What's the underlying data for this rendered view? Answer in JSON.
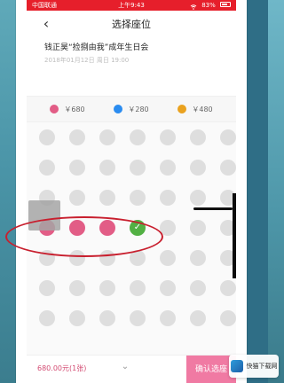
{
  "status": {
    "carrier": "中国联通",
    "time": "上午9:43",
    "battery": "83%"
  },
  "nav": {
    "title": "选择座位",
    "back_icon": "chevron-left-icon"
  },
  "event": {
    "name": "钱正昊“捡捌由我”成年生日会",
    "time": "2018年01月12日 周日 19:00"
  },
  "legend": [
    {
      "label": "￥680",
      "color": "#e25d86"
    },
    {
      "label": "￥280",
      "color": "#2b8cf0"
    },
    {
      "label": "￥480",
      "color": "#eaa21f"
    }
  ],
  "seats": {
    "rows": [
      [
        "available",
        "available",
        "available",
        "available",
        "available",
        "available",
        "available",
        "available"
      ],
      [
        "available",
        "available",
        "available",
        "available",
        "available",
        "available",
        "available",
        "available"
      ],
      [
        "available",
        "available",
        "available",
        "available",
        "available",
        "available",
        "available",
        "available"
      ],
      [
        "selected",
        "selected",
        "selected",
        "selected-check",
        "available",
        "available",
        "available",
        "available"
      ],
      [
        "available",
        "available",
        "available",
        "available",
        "available",
        "available",
        "available",
        "available"
      ],
      [
        "available",
        "available",
        "available",
        "available",
        "available",
        "available",
        "available",
        "available"
      ],
      [
        "available",
        "available",
        "available",
        "available",
        "available",
        "available",
        "available",
        "available"
      ]
    ],
    "available_color": "#dedede",
    "selected_color": "#e25d86",
    "check_color": "#52b043"
  },
  "bottom": {
    "price": "680.00元(1张)",
    "confirm_label": "确认选座"
  },
  "watermark": {
    "text": "快猫下载网"
  }
}
